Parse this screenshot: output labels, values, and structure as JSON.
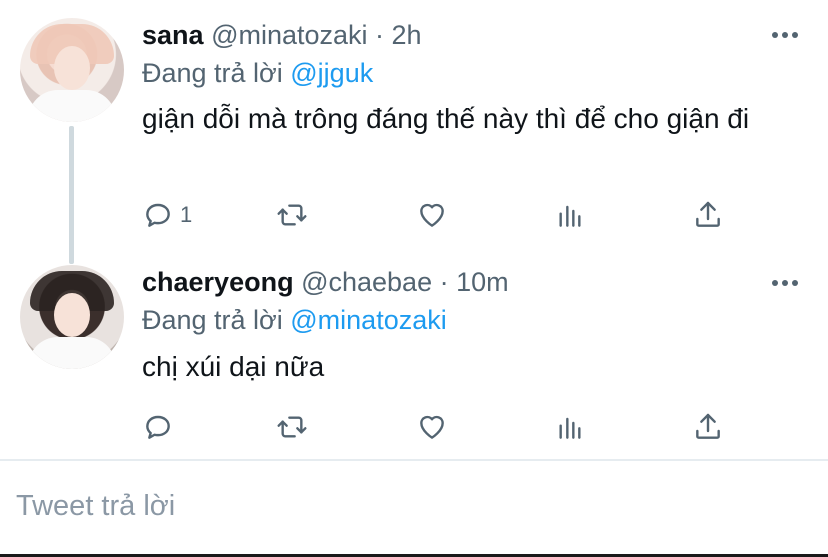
{
  "tweets": [
    {
      "name": "sana",
      "handle": "@minatozaki",
      "separator": " · ",
      "time": "2h",
      "reply_prefix": "Đang trả lời ",
      "reply_to": "@jjguk",
      "text": "giận dỗi mà trông đáng thế này thì để cho giận đi",
      "reply_count": "1",
      "avatar_icon": "profile-photo"
    },
    {
      "name": "chaeryeong",
      "handle": "@chaebae",
      "separator": " · ",
      "time": "10m",
      "reply_prefix": "Đang trả lời ",
      "reply_to": "@minatozaki",
      "text": "chị xúi dại nữa",
      "reply_count": "",
      "avatar_icon": "profile-photo"
    }
  ],
  "compose": {
    "placeholder": "Tweet trả lời"
  },
  "icons": {
    "reply": "speech-bubble-icon",
    "retweet": "retweet-arrows-icon",
    "like": "heart-icon",
    "stats": "bar-chart-icon",
    "share": "share-upload-icon",
    "more": "more-dots-icon"
  },
  "colors": {
    "link": "#1d9bf0",
    "secondary": "#536471",
    "text": "#0f1419",
    "thread_line": "#cfd9de"
  }
}
